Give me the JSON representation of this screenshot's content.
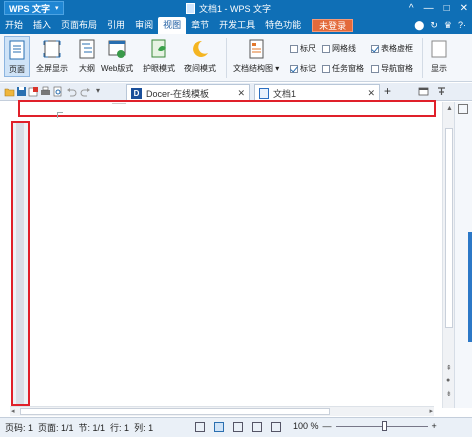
{
  "window": {
    "app_name": "WPS 文字",
    "doc_title": "文档1 - WPS 文字",
    "controls": [
      "^",
      "—",
      "□",
      "✕"
    ]
  },
  "menu": {
    "tabs": [
      "开始",
      "插入",
      "页面布局",
      "引用",
      "审阅",
      "视图",
      "章节",
      "开发工具",
      "特色功能"
    ],
    "active_tab": "视图",
    "login_label": "未登录",
    "right_icons": [
      "⬤",
      "↻",
      "♛",
      "?·"
    ]
  },
  "ribbon": {
    "buttons": [
      {
        "label": "页面",
        "selected": true
      },
      {
        "label": "全屏显示",
        "selected": false
      },
      {
        "label": "大纲",
        "selected": false
      },
      {
        "label": "Web版式",
        "selected": false
      },
      {
        "label": "护眼模式",
        "selected": false
      },
      {
        "label": "夜间模式",
        "selected": false
      },
      {
        "label": "文档结构图",
        "selected": false
      }
    ],
    "doc_structure_caret": "▾",
    "checkboxes": [
      {
        "label": "标尺",
        "checked": false
      },
      {
        "label": "网格线",
        "checked": false
      },
      {
        "label": "表格虚框",
        "checked": true
      },
      {
        "label": "标记",
        "checked": true
      },
      {
        "label": "任务窗格",
        "checked": false
      },
      {
        "label": "导航窗格",
        "checked": false
      }
    ],
    "overflow_label": "显示"
  },
  "quick_access": {
    "icons": [
      "open-folder-icon",
      "save-icon",
      "export-icon",
      "print-icon",
      "print-preview-icon",
      "undo-icon",
      "redo-icon"
    ],
    "doc_tabs": [
      {
        "label": "Docer-在线模板",
        "close": "✕"
      },
      {
        "label": "文档1",
        "close": "✕"
      }
    ],
    "new_tab": "+",
    "colors": {
      "docer": "#1a4f9a",
      "word": "#2c6fc1"
    }
  },
  "statusbar": {
    "page": "页码: 1",
    "pages": "页面: 1/1",
    "section": "节: 1/1",
    "row": "行: 1",
    "col": "列: 1",
    "zoom": "100 %",
    "minus": "—",
    "plus": "+"
  },
  "colors": {
    "title_bar": "#0f6fb6",
    "highlight_border": "#e0202a",
    "login_button": "#e36a3b"
  }
}
